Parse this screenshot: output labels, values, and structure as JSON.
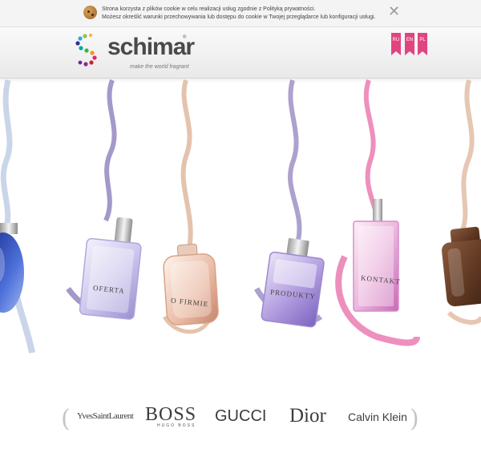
{
  "cookie_notice": {
    "line1": "Strona korzysta z plików cookie w celu realizacji usług zgodnie z Polityką prywatności.",
    "line2": "Możesz określić warunki przechowywania lub dostępu do cookie w Twojej przeglądarce lub konfiguracji usługi.",
    "close": "✕"
  },
  "header": {
    "logo_text": "schimar",
    "logo_tm": "®",
    "tagline": "make the world fragrant",
    "languages": [
      "RU",
      "EN",
      "PL"
    ]
  },
  "menu": {
    "oferta": "OFERTA",
    "o_firmie": "O FIRMIE",
    "produkty": "PRODUKTY",
    "kontakt": "KONTAKT"
  },
  "brands": {
    "prev": "(",
    "next": ")",
    "items": [
      "YvesSaintLaurent",
      "BOSS",
      "GUCCI",
      "Dior",
      "Calvin Klein"
    ],
    "boss_sub": "HUGO BOSS"
  },
  "colors": {
    "accent": "#e0457f",
    "ribbon_purple": "#8a7bb8",
    "ribbon_peach": "#d9a98a",
    "ribbon_pink": "#e86aa6",
    "ribbon_blue": "#9fb3d9"
  }
}
